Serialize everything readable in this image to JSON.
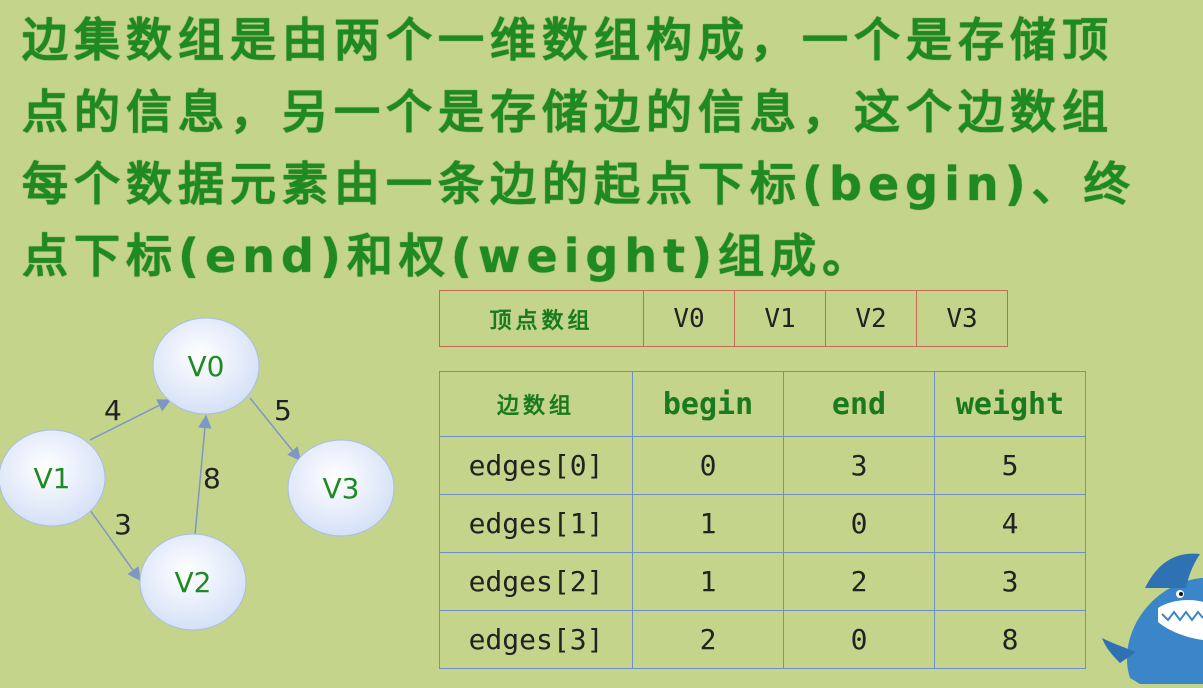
{
  "paragraph": {
    "lines": [
      "边集数组是由两个一维数组构成，一个是存储顶",
      "点的信息，另一个是存储边的信息，这个边数组",
      "每个数据元素由一条边的起点下标(begin)、终",
      "点下标(end)和权(weight)组成。"
    ]
  },
  "graph": {
    "nodes": [
      {
        "id": "V0",
        "label": "V0"
      },
      {
        "id": "V1",
        "label": "V1"
      },
      {
        "id": "V2",
        "label": "V2"
      },
      {
        "id": "V3",
        "label": "V3"
      }
    ],
    "edges": [
      {
        "from": "V1",
        "to": "V0",
        "weight": "4"
      },
      {
        "from": "V0",
        "to": "V3",
        "weight": "5"
      },
      {
        "from": "V1",
        "to": "V2",
        "weight": "3"
      },
      {
        "from": "V2",
        "to": "V0",
        "weight": "8"
      }
    ],
    "node_fill": "#e3ebfb",
    "edge_color": "#7d97c6"
  },
  "vertex_table": {
    "header": "顶点数组",
    "values": [
      "V0",
      "V1",
      "V2",
      "V3"
    ]
  },
  "edge_table": {
    "headers": [
      "边数组",
      "begin",
      "end",
      "weight"
    ],
    "rows": [
      [
        "edges[0]",
        "0",
        "3",
        "5"
      ],
      [
        "edges[1]",
        "1",
        "0",
        "4"
      ],
      [
        "edges[2]",
        "1",
        "2",
        "3"
      ],
      [
        "edges[3]",
        "2",
        "0",
        "8"
      ]
    ]
  },
  "colors": {
    "background": "#c4d48a",
    "heading_text": "#1f8a22",
    "vertex_table_border": "#c46a55",
    "edge_table_border": "#6f8fc9"
  },
  "icons": {
    "mascot": "shark-mascot-icon"
  }
}
